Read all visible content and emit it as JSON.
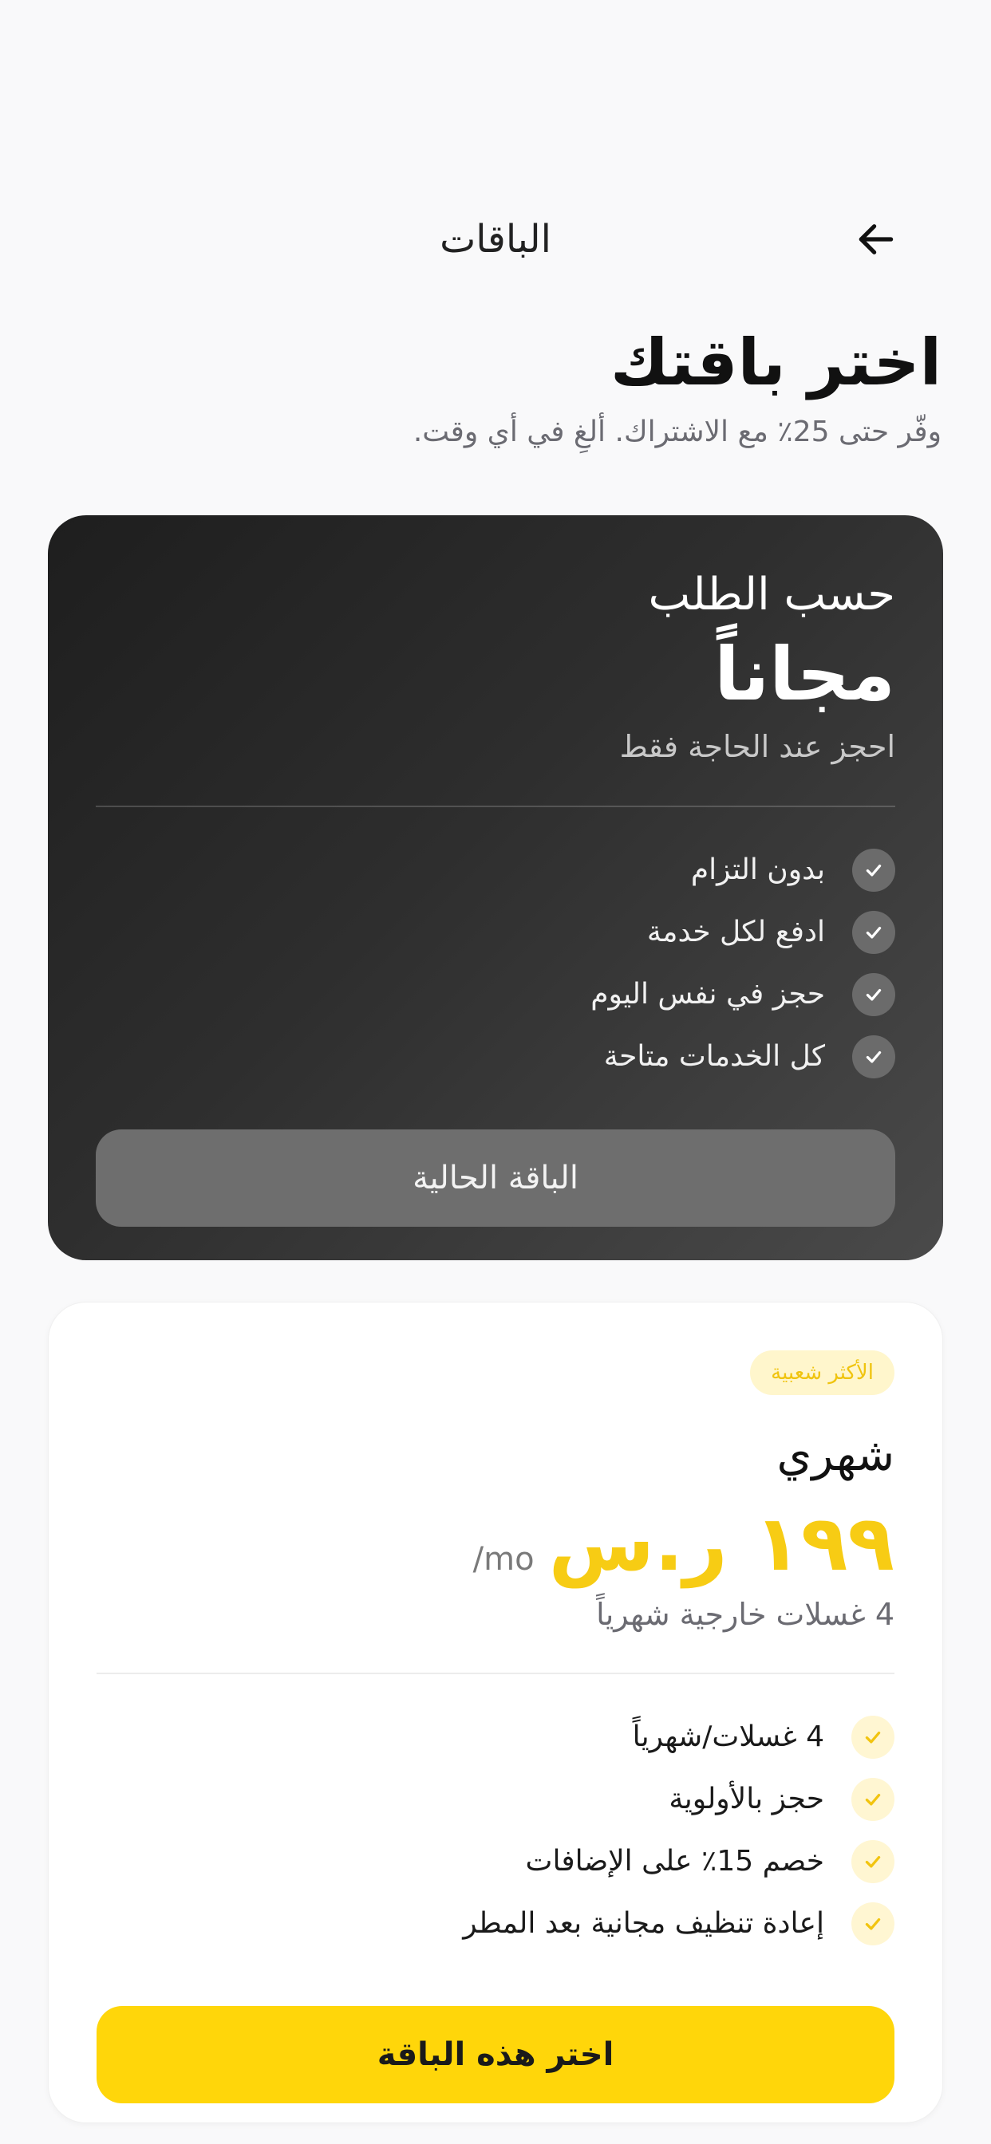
{
  "header": {
    "title": "الباقات",
    "back_icon": "arrow-left-icon"
  },
  "page": {
    "title": "اختر باقتك",
    "subtitle": "وفّر حتى 25٪ مع الاشتراك. ألغِ في أي وقت."
  },
  "plans": [
    {
      "name": "حسب الطلب",
      "price": "مجاناً",
      "description": "احجز عند الحاجة فقط",
      "features": [
        "بدون التزام",
        "ادفع لكل خدمة",
        "حجز في نفس اليوم",
        "كل الخدمات متاحة"
      ],
      "button_label": "الباقة الحالية"
    },
    {
      "badge": "الأكثر شعبية",
      "name": "شهري",
      "price": "١٩٩ ر.س",
      "price_unit": "/mo",
      "description": "4 غسلات خارجية شهرياً",
      "features": [
        "4 غسلات/شهرياً",
        "حجز بالأولوية",
        "خصم 15٪ على الإضافات",
        "إعادة تنظيف مجانية بعد المطر"
      ],
      "button_label": "اختر هذه الباقة"
    }
  ],
  "colors": {
    "accent": "#ffd60a",
    "dark_card": "#2e2e2e",
    "background": "#f9f9fa"
  }
}
